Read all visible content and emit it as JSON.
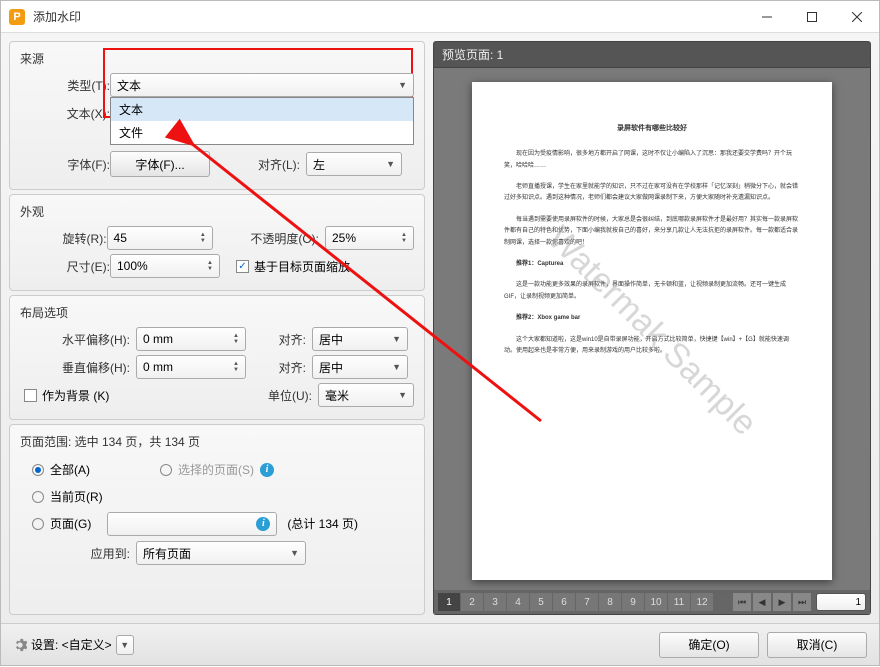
{
  "window": {
    "title": "添加水印"
  },
  "groups": {
    "source": "来源",
    "appearance": "外观",
    "layout": "布局选项",
    "range_title": "页面范围: 选中 134 页，共 134 页"
  },
  "source": {
    "type_label": "类型(T):",
    "type_value": "文本",
    "text_label": "文本(X):",
    "dropdown": {
      "opt_text": "文本",
      "opt_file": "文件"
    },
    "font_label": "字体(F):",
    "font_btn": "字体(F)...",
    "align_label": "对齐(L):",
    "align_value": "左"
  },
  "appearance": {
    "rotate_label": "旋转(R):",
    "rotate_value": "45",
    "opacity_label": "不透明度(O):",
    "opacity_value": "25%",
    "size_label": "尺寸(E):",
    "size_value": "100%",
    "scale_label": "基于目标页面缩放"
  },
  "layout": {
    "hoff_label": "水平偏移(H):",
    "hoff_value": "0 mm",
    "voff_label": "垂直偏移(H):",
    "voff_value": "0 mm",
    "align_label": "对齐:",
    "halign_value": "居中",
    "valign_value": "居中",
    "bg_label": "作为背景 (K)",
    "unit_label": "单位(U):",
    "unit_value": "毫米"
  },
  "range": {
    "all_label": "全部(A)",
    "selected_label": "选择的页面(S)",
    "current_label": "当前页(R)",
    "pages_label": "页面(G)",
    "total_label": "(总计 134 页)",
    "apply_label": "应用到:",
    "apply_value": "所有页面"
  },
  "preview": {
    "title": "预览页面: 1",
    "doc_title": "录屏软件有哪些比较好",
    "p1": "现在因为受疫情影响，很多地方都开启了网课，这时不仅让小编陷入了沉思：那我还要交学费吗？开个玩笑，哈哈哈……",
    "p2": "老师直播授课，学生在家里就能学的知识，只不过在家可没有在学校那样「记忆深刻」稍微分下心，就会错过好多知识点。遇到这种情况，老师们都会建议大家做网课录制下来，方便大家随时补充遗漏知识点。",
    "p3": "每当遇到需要使用录屏软件的时候，大家总是会很纠结，到底哪款录屏软件才是最好用？其实每一款录屏软件都有自己的特色和优势，下面小编我就按自己的喜好，来分享几款让人无法抗拒的录屏软件。每一款都适合录制网课，选择一款你喜欢的吧！",
    "r1": "推荐1：Capturea",
    "p4": "这是一款功能更多效果的录屏软件，界面操作简单，无卡顿和蓝，让视频录制更加流畅。还可一键生成GIF，让录制视频更加简单。",
    "r2": "推荐2：Xbox game bar",
    "p5": "这个大家都知道啦，这是win10是自带录屏功能，开启方式比较简单，快捷键【win】+【G】就能快速调动。使用起来也是非常方便，用来录制游戏的用户比较多啦。",
    "watermark": "Watermak Sample",
    "pages": [
      "1",
      "2",
      "3",
      "4",
      "5",
      "6",
      "7",
      "8",
      "9",
      "10",
      "11",
      "12"
    ],
    "current": "1"
  },
  "footer": {
    "settings_label": "设置: <自定义>",
    "ok": "确定(O)",
    "cancel": "取消(C)"
  }
}
